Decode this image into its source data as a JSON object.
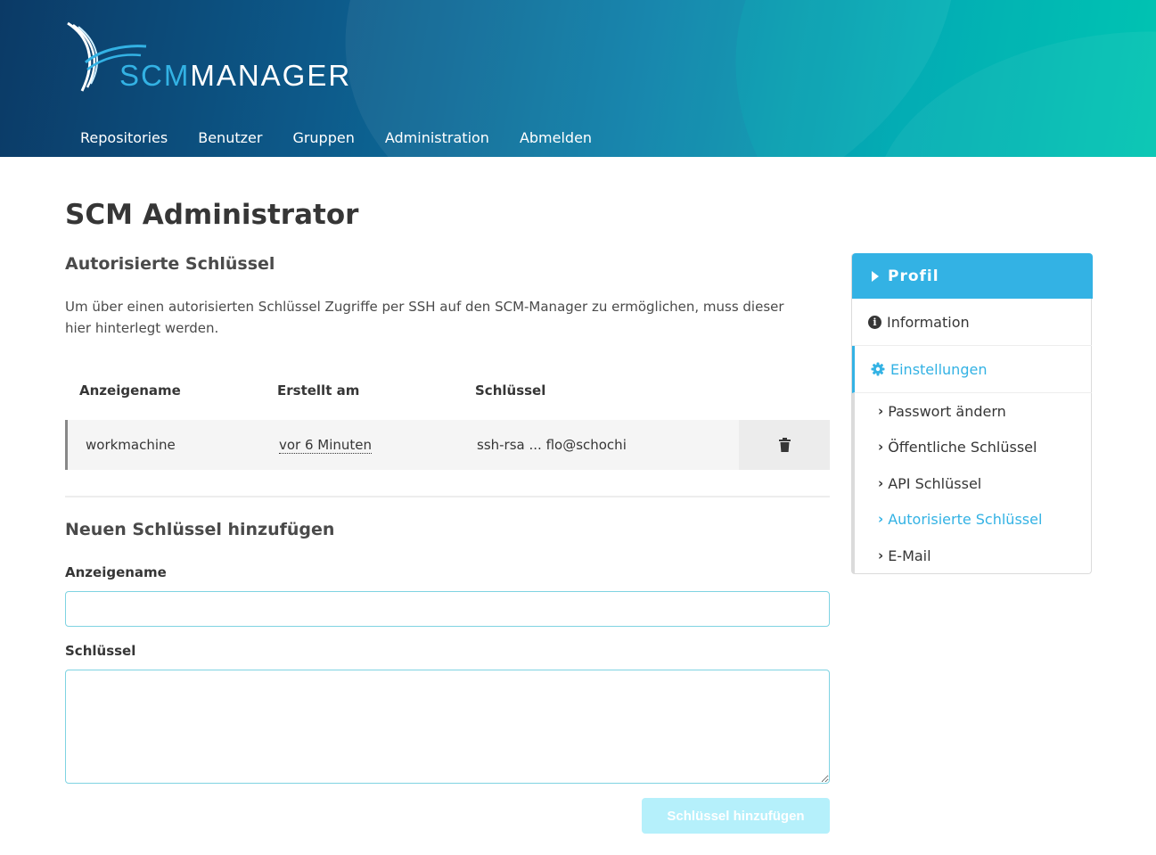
{
  "app": {
    "logo": {
      "part1": "SCM",
      "part2": "MANAGER"
    }
  },
  "nav": [
    {
      "label": "Repositories"
    },
    {
      "label": "Benutzer"
    },
    {
      "label": "Gruppen"
    },
    {
      "label": "Administration"
    },
    {
      "label": "Abmelden"
    }
  ],
  "page": {
    "title": "SCM Administrator",
    "subtitle": "Autorisierte Schlüssel",
    "description": "Um über einen autorisierten Schlüssel Zugriffe per SSH auf den SCM-Manager zu ermöglichen, muss dieser hier hinterlegt werden."
  },
  "table": {
    "headers": [
      "Anzeigename",
      "Erstellt am",
      "Schlüssel"
    ],
    "rows": [
      {
        "name": "workmachine",
        "created": "vor 6 Minuten",
        "key": "ssh-rsa ... flo@schochi"
      }
    ]
  },
  "form": {
    "title": "Neuen Schlüssel hinzufügen",
    "name_label": "Anzeigename",
    "name_value": "",
    "key_label": "Schlüssel",
    "key_value": "",
    "submit_label": "Schlüssel hinzufügen"
  },
  "sidebar": {
    "header": "Profil",
    "information": "Information",
    "settings": "Einstellungen",
    "items": [
      {
        "label": "Passwort ändern"
      },
      {
        "label": "Öffentliche Schlüssel"
      },
      {
        "label": "API Schlüssel"
      },
      {
        "label": "Autorisierte Schlüssel"
      },
      {
        "label": "E-Mail"
      }
    ],
    "active_item": "Autorisierte Schlüssel"
  },
  "colors": {
    "accent": "#33b2e4",
    "header_dark": "#0b3a66",
    "header_light": "#00c2b0",
    "button_disabled": "#b5f0fb"
  }
}
